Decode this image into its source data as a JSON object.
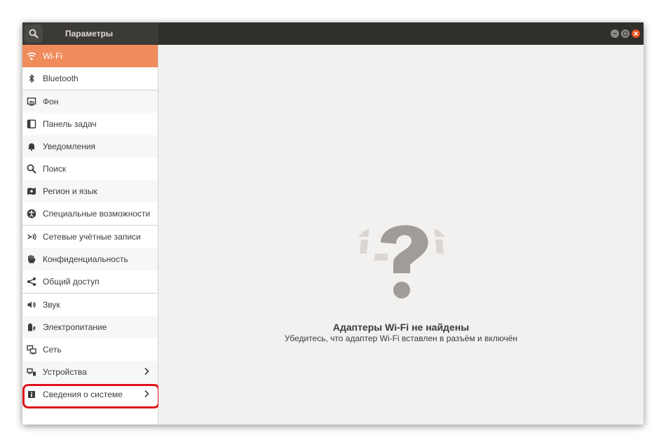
{
  "window": {
    "title": "Параметры",
    "accent_color": "#f08b5b",
    "highlight_color": "#e0141c",
    "controls": [
      "minimize-icon",
      "maximize-icon",
      "close-icon"
    ]
  },
  "sidebar": {
    "items": [
      {
        "label": "Wi-Fi",
        "icon": "wifi-icon",
        "selected": true
      },
      {
        "label": "Bluetooth",
        "icon": "bluetooth-icon"
      },
      {
        "label": "Фон",
        "icon": "background-icon"
      },
      {
        "label": "Панель задач",
        "icon": "dock-icon"
      },
      {
        "label": "Уведомления",
        "icon": "bell-icon"
      },
      {
        "label": "Поиск",
        "icon": "search-icon"
      },
      {
        "label": "Регион и язык",
        "icon": "region-icon"
      },
      {
        "label": "Специальные возможности",
        "icon": "accessibility-icon"
      },
      {
        "label": "Сетевые учётные записи",
        "icon": "online-accounts-icon"
      },
      {
        "label": "Конфиденциальность",
        "icon": "privacy-hand-icon"
      },
      {
        "label": "Общий доступ",
        "icon": "share-icon"
      },
      {
        "label": "Звук",
        "icon": "speaker-icon"
      },
      {
        "label": "Электропитание",
        "icon": "power-icon"
      },
      {
        "label": "Сеть",
        "icon": "network-icon"
      },
      {
        "label": "Устройства",
        "icon": "devices-icon",
        "has_submenu": true
      },
      {
        "label": "Сведения о системе",
        "icon": "info-icon",
        "has_submenu": true,
        "highlighted": true
      }
    ]
  },
  "content": {
    "placeholder_icon": "question-mark-icon",
    "title": "Адаптеры Wi-Fi не найдены",
    "subtitle": "Убедитесь, что адаптер Wi-Fi вставлен в разъём и включён"
  }
}
